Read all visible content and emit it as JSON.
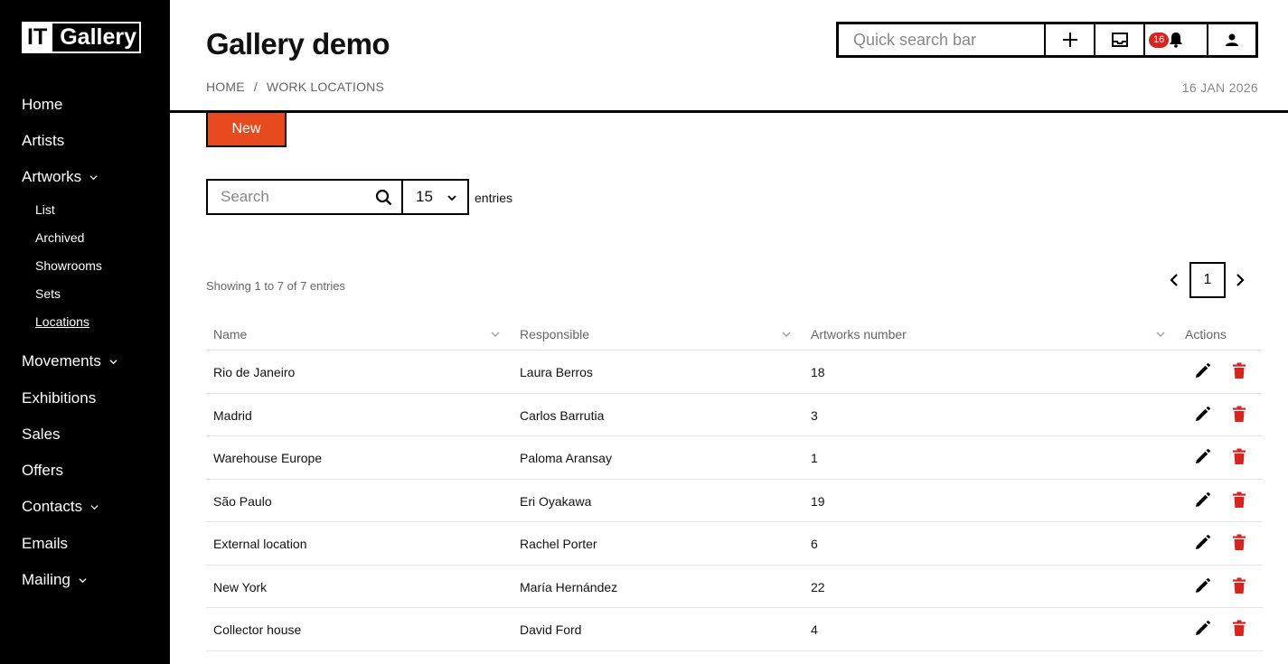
{
  "brand": {
    "logo_it": "IT",
    "logo_gallery": "Gallery"
  },
  "sidebar": {
    "items": [
      {
        "label": "Home"
      },
      {
        "label": "Artists"
      },
      {
        "label": "Artworks",
        "expandable": true
      },
      {
        "label": "List",
        "sub": true
      },
      {
        "label": "Archived",
        "sub": true
      },
      {
        "label": "Showrooms",
        "sub": true
      },
      {
        "label": "Sets",
        "sub": true
      },
      {
        "label": "Locations",
        "sub": true,
        "active": true
      },
      {
        "label": "Movements",
        "expandable": true
      },
      {
        "label": "Exhibitions"
      },
      {
        "label": "Sales"
      },
      {
        "label": "Offers"
      },
      {
        "label": "Contacts",
        "expandable": true
      },
      {
        "label": "Emails"
      },
      {
        "label": "Mailing",
        "expandable": true
      }
    ]
  },
  "header": {
    "title": "Gallery demo",
    "breadcrumb": [
      "HOME",
      "WORK LOCATIONS"
    ],
    "breadcrumb_sep": "/",
    "date": "16 JAN 2026",
    "quick_search_placeholder": "Quick search bar",
    "notification_count": "16",
    "icons": [
      "plus-icon",
      "inbox-icon",
      "bell-icon",
      "user-icon"
    ]
  },
  "toolbar": {
    "new_label": "New",
    "search_placeholder": "Search",
    "per_page": "15",
    "entries_label": "entries"
  },
  "listing": {
    "showing": "Showing 1 to 7 of 7 entries",
    "current_page": "1"
  },
  "table": {
    "columns": [
      "Name",
      "Responsible",
      "Artworks number",
      "Actions"
    ],
    "rows": [
      {
        "name": "Rio de Janeiro",
        "responsible": "Laura Berros",
        "artworks": "18"
      },
      {
        "name": "Madrid",
        "responsible": "Carlos Barrutia",
        "artworks": "3"
      },
      {
        "name": "Warehouse Europe",
        "responsible": "Paloma Aransay",
        "artworks": "1"
      },
      {
        "name": "São Paulo",
        "responsible": "Eri Oyakawa",
        "artworks": "19"
      },
      {
        "name": "External location",
        "responsible": "Rachel Porter",
        "artworks": "6"
      },
      {
        "name": "New York",
        "responsible": "María Hernández",
        "artworks": "22"
      },
      {
        "name": "Collector house",
        "responsible": "David Ford",
        "artworks": "4"
      }
    ]
  },
  "colors": {
    "accent": "#e84a1f",
    "delete": "#d9231f",
    "badge": "#d9231f"
  }
}
